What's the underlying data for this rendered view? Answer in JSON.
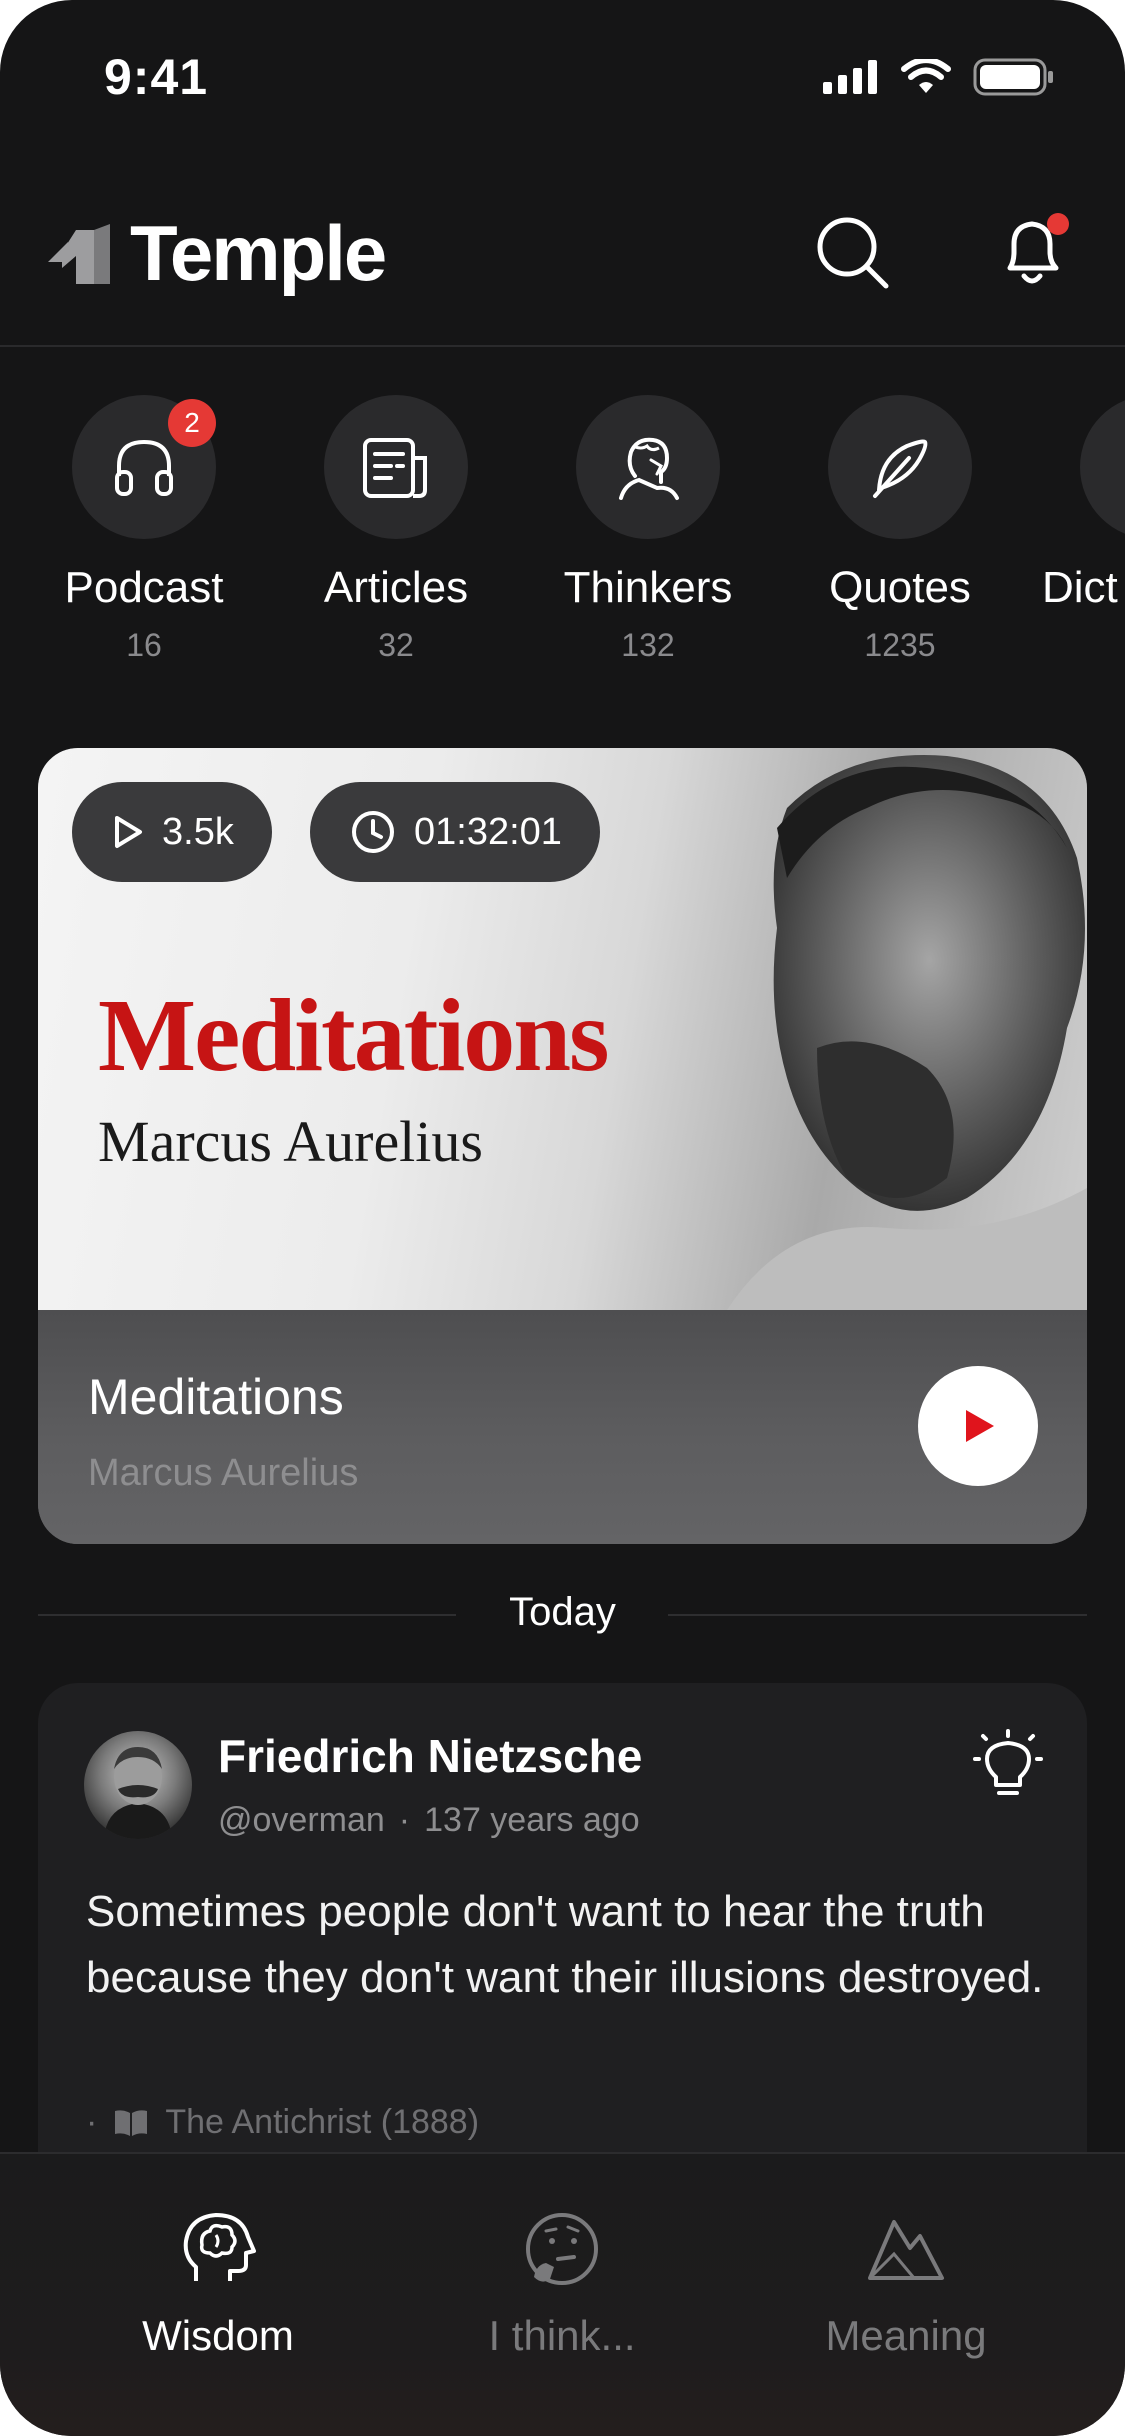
{
  "status_bar": {
    "time": "9:41"
  },
  "header": {
    "app_name": "Temple"
  },
  "categories": [
    {
      "label": "Podcast",
      "count": "16",
      "badge": "2",
      "icon": "headphones-icon"
    },
    {
      "label": "Articles",
      "count": "32",
      "icon": "newspaper-icon"
    },
    {
      "label": "Thinkers",
      "count": "132",
      "icon": "thinker-bust-icon"
    },
    {
      "label": "Quotes",
      "count": "1235",
      "icon": "feather-icon"
    },
    {
      "label": "Dict",
      "icon": "dictionary-icon"
    }
  ],
  "featured": {
    "plays": "3.5k",
    "duration": "01:32:01",
    "art_title": "Meditations",
    "art_subtitle": "Marcus Aurelius",
    "title": "Meditations",
    "author": "Marcus Aurelius"
  },
  "section_label": "Today",
  "quote_card": {
    "author": "Friedrich Nietzsche",
    "handle": "@overman",
    "separator": "·",
    "time_ago": "137 years ago",
    "text": "Sometimes people don't want to hear the truth because they don't want their illusions destroyed.",
    "source_prefix": "·",
    "source": "The Antichrist (1888)"
  },
  "bottom_nav": [
    {
      "label": "Wisdom",
      "icon": "brain-head-icon",
      "active": true
    },
    {
      "label": "I think...",
      "icon": "thinking-face-icon",
      "active": false
    },
    {
      "label": "Meaning",
      "icon": "mountain-icon",
      "active": false
    }
  ],
  "colors": {
    "background": "#151516",
    "accent_red": "#e53935",
    "title_red": "#c61414",
    "muted_text": "#8e8e90"
  }
}
